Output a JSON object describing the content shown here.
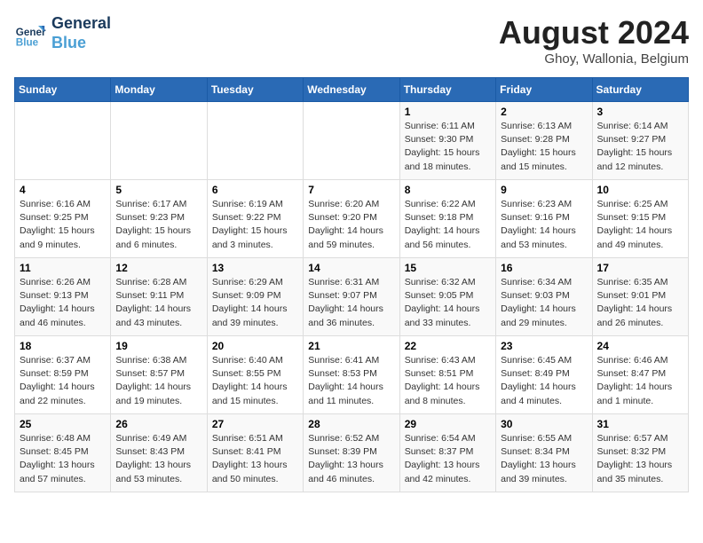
{
  "header": {
    "logo_line1": "General",
    "logo_line2": "Blue",
    "month_year": "August 2024",
    "location": "Ghoy, Wallonia, Belgium"
  },
  "days_of_week": [
    "Sunday",
    "Monday",
    "Tuesday",
    "Wednesday",
    "Thursday",
    "Friday",
    "Saturday"
  ],
  "weeks": [
    [
      {
        "day": "",
        "info": ""
      },
      {
        "day": "",
        "info": ""
      },
      {
        "day": "",
        "info": ""
      },
      {
        "day": "",
        "info": ""
      },
      {
        "day": "1",
        "info": "Sunrise: 6:11 AM\nSunset: 9:30 PM\nDaylight: 15 hours\nand 18 minutes."
      },
      {
        "day": "2",
        "info": "Sunrise: 6:13 AM\nSunset: 9:28 PM\nDaylight: 15 hours\nand 15 minutes."
      },
      {
        "day": "3",
        "info": "Sunrise: 6:14 AM\nSunset: 9:27 PM\nDaylight: 15 hours\nand 12 minutes."
      }
    ],
    [
      {
        "day": "4",
        "info": "Sunrise: 6:16 AM\nSunset: 9:25 PM\nDaylight: 15 hours\nand 9 minutes."
      },
      {
        "day": "5",
        "info": "Sunrise: 6:17 AM\nSunset: 9:23 PM\nDaylight: 15 hours\nand 6 minutes."
      },
      {
        "day": "6",
        "info": "Sunrise: 6:19 AM\nSunset: 9:22 PM\nDaylight: 15 hours\nand 3 minutes."
      },
      {
        "day": "7",
        "info": "Sunrise: 6:20 AM\nSunset: 9:20 PM\nDaylight: 14 hours\nand 59 minutes."
      },
      {
        "day": "8",
        "info": "Sunrise: 6:22 AM\nSunset: 9:18 PM\nDaylight: 14 hours\nand 56 minutes."
      },
      {
        "day": "9",
        "info": "Sunrise: 6:23 AM\nSunset: 9:16 PM\nDaylight: 14 hours\nand 53 minutes."
      },
      {
        "day": "10",
        "info": "Sunrise: 6:25 AM\nSunset: 9:15 PM\nDaylight: 14 hours\nand 49 minutes."
      }
    ],
    [
      {
        "day": "11",
        "info": "Sunrise: 6:26 AM\nSunset: 9:13 PM\nDaylight: 14 hours\nand 46 minutes."
      },
      {
        "day": "12",
        "info": "Sunrise: 6:28 AM\nSunset: 9:11 PM\nDaylight: 14 hours\nand 43 minutes."
      },
      {
        "day": "13",
        "info": "Sunrise: 6:29 AM\nSunset: 9:09 PM\nDaylight: 14 hours\nand 39 minutes."
      },
      {
        "day": "14",
        "info": "Sunrise: 6:31 AM\nSunset: 9:07 PM\nDaylight: 14 hours\nand 36 minutes."
      },
      {
        "day": "15",
        "info": "Sunrise: 6:32 AM\nSunset: 9:05 PM\nDaylight: 14 hours\nand 33 minutes."
      },
      {
        "day": "16",
        "info": "Sunrise: 6:34 AM\nSunset: 9:03 PM\nDaylight: 14 hours\nand 29 minutes."
      },
      {
        "day": "17",
        "info": "Sunrise: 6:35 AM\nSunset: 9:01 PM\nDaylight: 14 hours\nand 26 minutes."
      }
    ],
    [
      {
        "day": "18",
        "info": "Sunrise: 6:37 AM\nSunset: 8:59 PM\nDaylight: 14 hours\nand 22 minutes."
      },
      {
        "day": "19",
        "info": "Sunrise: 6:38 AM\nSunset: 8:57 PM\nDaylight: 14 hours\nand 19 minutes."
      },
      {
        "day": "20",
        "info": "Sunrise: 6:40 AM\nSunset: 8:55 PM\nDaylight: 14 hours\nand 15 minutes."
      },
      {
        "day": "21",
        "info": "Sunrise: 6:41 AM\nSunset: 8:53 PM\nDaylight: 14 hours\nand 11 minutes."
      },
      {
        "day": "22",
        "info": "Sunrise: 6:43 AM\nSunset: 8:51 PM\nDaylight: 14 hours\nand 8 minutes."
      },
      {
        "day": "23",
        "info": "Sunrise: 6:45 AM\nSunset: 8:49 PM\nDaylight: 14 hours\nand 4 minutes."
      },
      {
        "day": "24",
        "info": "Sunrise: 6:46 AM\nSunset: 8:47 PM\nDaylight: 14 hours\nand 1 minute."
      }
    ],
    [
      {
        "day": "25",
        "info": "Sunrise: 6:48 AM\nSunset: 8:45 PM\nDaylight: 13 hours\nand 57 minutes."
      },
      {
        "day": "26",
        "info": "Sunrise: 6:49 AM\nSunset: 8:43 PM\nDaylight: 13 hours\nand 53 minutes."
      },
      {
        "day": "27",
        "info": "Sunrise: 6:51 AM\nSunset: 8:41 PM\nDaylight: 13 hours\nand 50 minutes."
      },
      {
        "day": "28",
        "info": "Sunrise: 6:52 AM\nSunset: 8:39 PM\nDaylight: 13 hours\nand 46 minutes."
      },
      {
        "day": "29",
        "info": "Sunrise: 6:54 AM\nSunset: 8:37 PM\nDaylight: 13 hours\nand 42 minutes."
      },
      {
        "day": "30",
        "info": "Sunrise: 6:55 AM\nSunset: 8:34 PM\nDaylight: 13 hours\nand 39 minutes."
      },
      {
        "day": "31",
        "info": "Sunrise: 6:57 AM\nSunset: 8:32 PM\nDaylight: 13 hours\nand 35 minutes."
      }
    ]
  ]
}
